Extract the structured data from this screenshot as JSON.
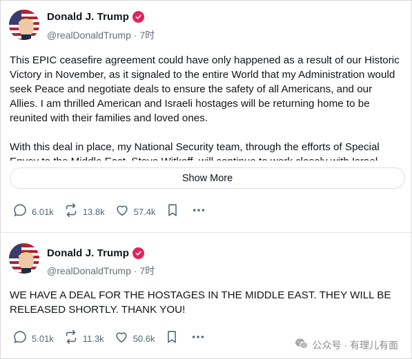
{
  "posts": [
    {
      "author": {
        "display_name": "Donald J. Trump",
        "handle": "@realDonaldTrump",
        "separator": "·",
        "time": "7时"
      },
      "paragraphs": [
        "This EPIC ceasefire agreement could have only happened as a result of our Historic Victory in November, as it signaled to the entire World that my Administration would seek Peace and negotiate deals to ensure the safety of all Americans, and our Allies. I am thrilled American and Israeli hostages will be returning home to be reunited with their families and loved ones.",
        "With this deal in place, my National Security team, through the efforts of Special Envoy to the Middle East, Steve Witkoff, will continue to work closely with Israel"
      ],
      "show_more_label": "Show More",
      "stats": {
        "replies": "6.01k",
        "reposts": "13.8k",
        "likes": "57.4k"
      }
    },
    {
      "author": {
        "display_name": "Donald J. Trump",
        "handle": "@realDonaldTrump",
        "separator": "·",
        "time": "7时"
      },
      "paragraphs": [
        "WE HAVE A DEAL FOR THE HOSTAGES IN THE MIDDLE EAST. THEY WILL BE RELEASED SHORTLY. THANK YOU!"
      ],
      "stats": {
        "replies": "5.01k",
        "reposts": "11.3k",
        "likes": "50.6k"
      }
    }
  ],
  "watermark": {
    "text": "公众号 · 有理儿有面"
  },
  "colors": {
    "verified": "#e0245e",
    "text": "#0f1419",
    "muted": "#656d76",
    "border": "#dcdfe3"
  },
  "icons": [
    "verified-badge-icon",
    "reply-icon",
    "repost-icon",
    "like-icon",
    "bookmark-icon",
    "more-icon",
    "wechat-icon"
  ]
}
